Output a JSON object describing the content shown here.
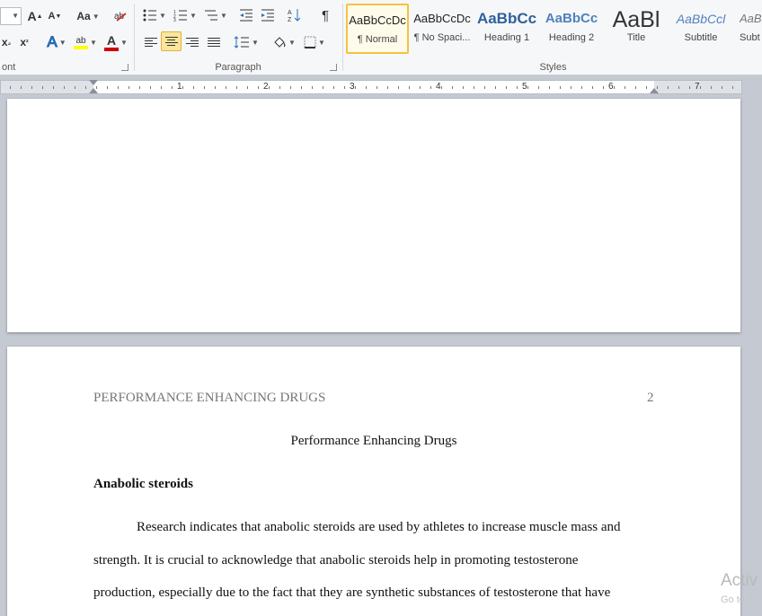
{
  "ribbon": {
    "groups": {
      "font": "ont",
      "paragraph": "Paragraph",
      "styles": "Styles"
    },
    "font_buttons": {
      "grow": "A",
      "shrink": "A",
      "change_case": "Aa",
      "subscript": "x",
      "superscript": "x",
      "text_effects": "A",
      "highlight": "ab",
      "font_color": "A"
    },
    "paragraph_buttons": {
      "sort": "A↓Z",
      "show_marks": "¶"
    },
    "styles": [
      {
        "preview": "AaBbCcDc",
        "name": "¶ Normal",
        "selected": true,
        "color": "#000000"
      },
      {
        "preview": "AaBbCcDc",
        "name": "¶ No Spaci...",
        "selected": false,
        "color": "#000000"
      },
      {
        "preview": "AaBbCc",
        "name": "Heading 1",
        "selected": false,
        "color": "#2f5f9b"
      },
      {
        "preview": "AaBbCc",
        "name": "Heading 2",
        "selected": false,
        "color": "#4f81bd"
      },
      {
        "preview": "AaBl",
        "name": "Title",
        "selected": false,
        "color": "#333333"
      },
      {
        "preview": "AaBbCcl",
        "name": "Subtitle",
        "selected": false,
        "color": "#4f81bd"
      },
      {
        "preview": "AaB",
        "name": "Subt",
        "selected": false,
        "color": "#777777"
      }
    ],
    "colors": {
      "highlight": "#ffff00",
      "font_color": "#d00000",
      "selected_border": "#f4c243"
    }
  },
  "ruler": {
    "numbers": [
      "1",
      "2",
      "3",
      "4",
      "5",
      "6",
      "7"
    ]
  },
  "document": {
    "running_head": "PERFORMANCE ENHANCING DRUGS",
    "page_number": "2",
    "title": "Performance Enhancing Drugs",
    "heading": "Anabolic steroids",
    "lines": [
      "Research indicates that anabolic steroids are used by athletes to increase muscle mass and",
      "strength. It is crucial  to acknowledge that anabolic  steroids help in promoting testosterone",
      "production, especially  due to the fact that they are synthetic substances of testosterone that have"
    ]
  },
  "watermark": {
    "line1": "Activ",
    "line2": "Go to S"
  }
}
